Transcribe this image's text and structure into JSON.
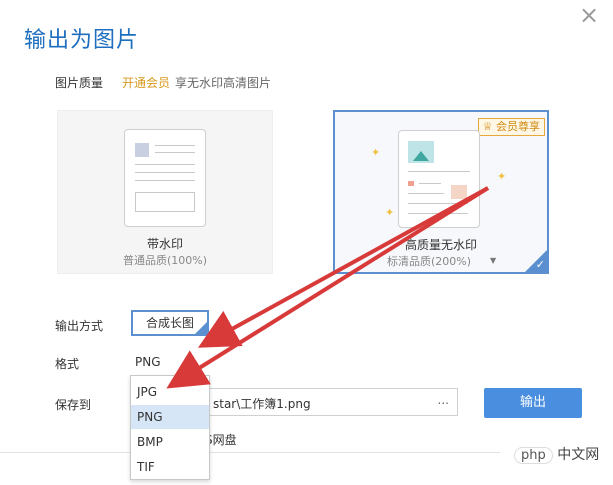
{
  "dialog": {
    "title": "输出为图片",
    "close_icon": "close-icon"
  },
  "quality": {
    "label": "图片质量",
    "vip_link": "开通会员",
    "vip_desc": "享无水印高清图片",
    "cards": [
      {
        "title": "带水印",
        "subtitle": "普通品质(100%)"
      },
      {
        "title": "高质量无水印",
        "subtitle": "标清品质(200%)",
        "badge": "会员尊享",
        "selected": true
      }
    ]
  },
  "output_mode": {
    "label": "输出方式",
    "value": "合成长图"
  },
  "format": {
    "label": "格式",
    "value": "PNG",
    "options": [
      "JPG",
      "PNG",
      "BMP",
      "TIF"
    ],
    "selected_option": "PNG"
  },
  "save": {
    "label": "保存到",
    "path": "star\\工作簿1.png",
    "more": "...",
    "cloud_text": "S网盘"
  },
  "export_button": {
    "label": "输出"
  },
  "watermark": {
    "brand": "php",
    "text": "中文网"
  },
  "colors": {
    "accent": "#4a8ee0",
    "vip": "#d89a1d",
    "annotation_arrow": "#d83a3a"
  }
}
